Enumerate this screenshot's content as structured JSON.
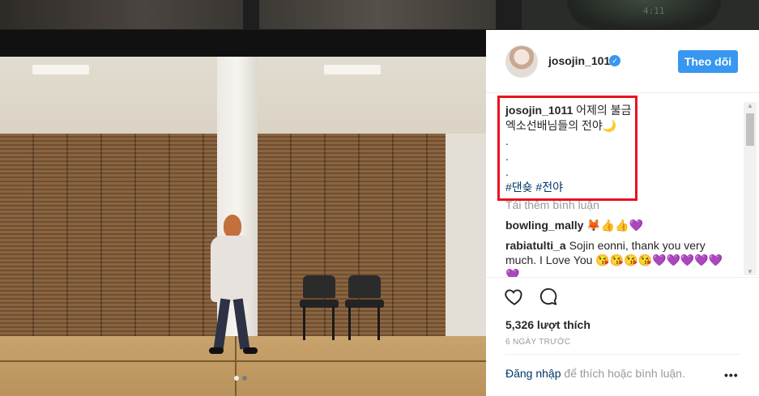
{
  "background": {
    "time_readout": "4:11"
  },
  "media": {
    "carousel_dots": [
      true,
      false
    ]
  },
  "post": {
    "header": {
      "username": "josojin_1011",
      "verified": true,
      "follow_label": "Theo dõi"
    },
    "caption": {
      "username": "josojin_1011",
      "lines": [
        "어제의 불금",
        "엑소선배님들의 전야🌙",
        ".",
        ".",
        "."
      ],
      "hashtags": "#댄숒 #전야"
    },
    "load_more": "Tải thêm bình luận",
    "comments": [
      {
        "user": "bowling_mally",
        "text": "🦊👍👍💜"
      },
      {
        "user": "rabiatulti_a",
        "text": "Sojin eonni, thank you very much. I Love You 😘😘😘😘💜💜💜💜💜💜"
      }
    ],
    "likes": "5,326 lượt thích",
    "time_ago": "6 NGÀY TRƯỚC",
    "login_prompt": {
      "link": "Đăng nhập",
      "rest": " để thích hoặc bình luận."
    },
    "icons": {
      "like": "heart-outline-icon",
      "comment": "comment-bubble-icon",
      "more": "more-options-icon"
    },
    "colors": {
      "accent": "#3897f0",
      "highlight_box": "#e8141f",
      "hashtag": "#003569"
    }
  }
}
